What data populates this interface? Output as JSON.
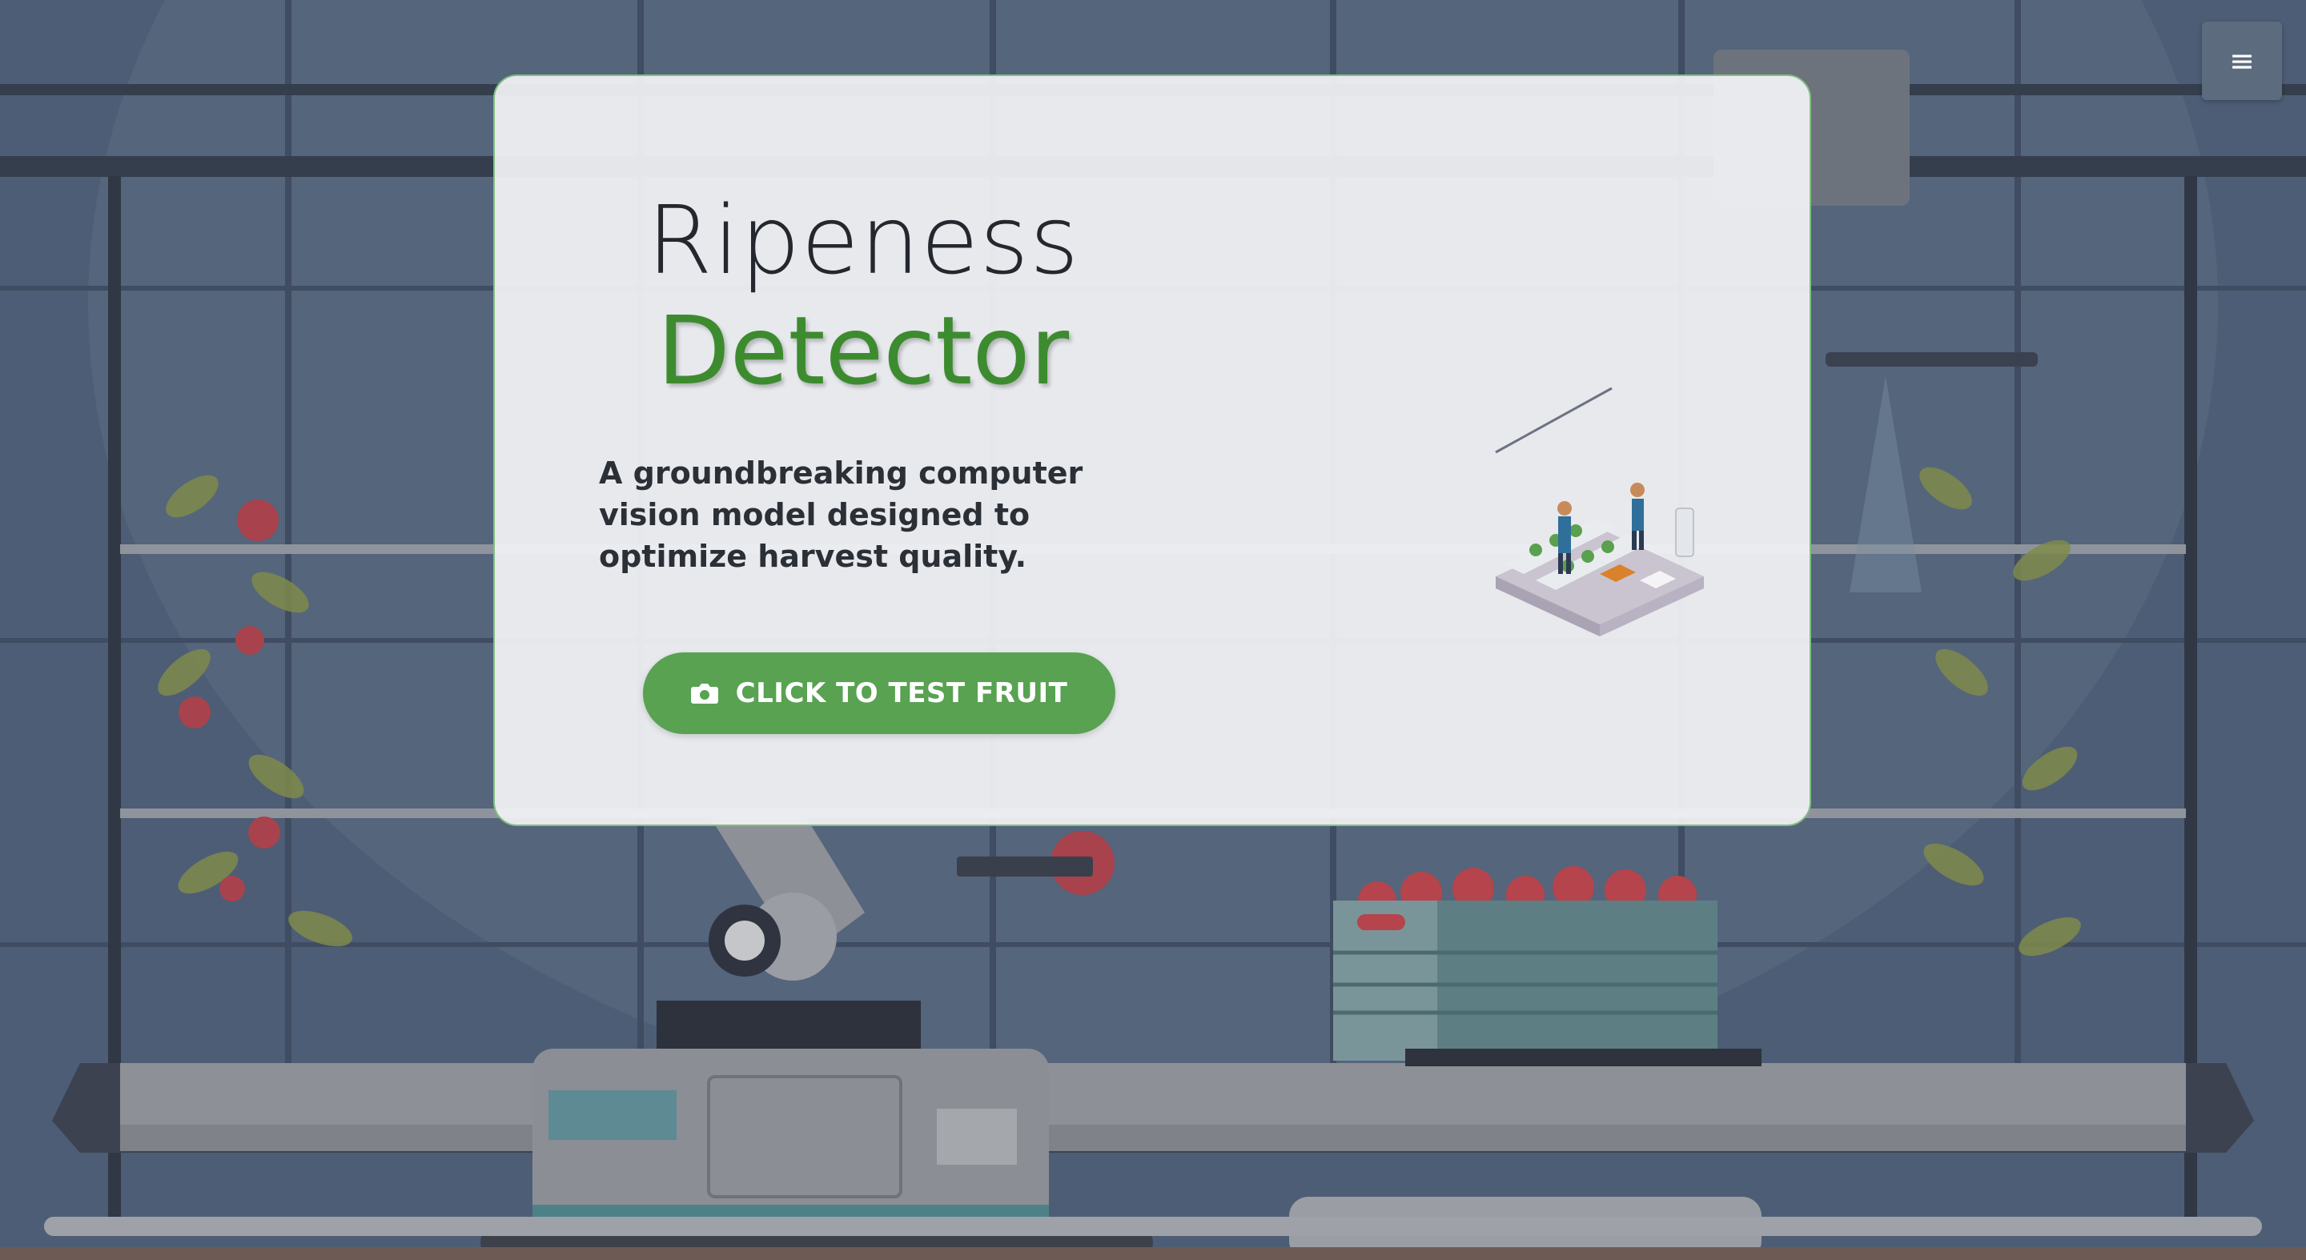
{
  "header": {
    "menu_icon": "hamburger-menu-icon",
    "menu_glyph": "≡"
  },
  "hero": {
    "title_line1": "Ripeness",
    "title_line2": "Detector",
    "description": "A groundbreaking computer vision model designed to optimize harvest quality.",
    "cta_label": "CLICK TO TEST FRUIT",
    "cta_icon": "camera-icon",
    "illustration": "greenhouse-workers-illustration"
  },
  "colors": {
    "accent_green": "#3d8b2f",
    "button_green": "#58a251",
    "background_navy": "#4d5d75"
  }
}
